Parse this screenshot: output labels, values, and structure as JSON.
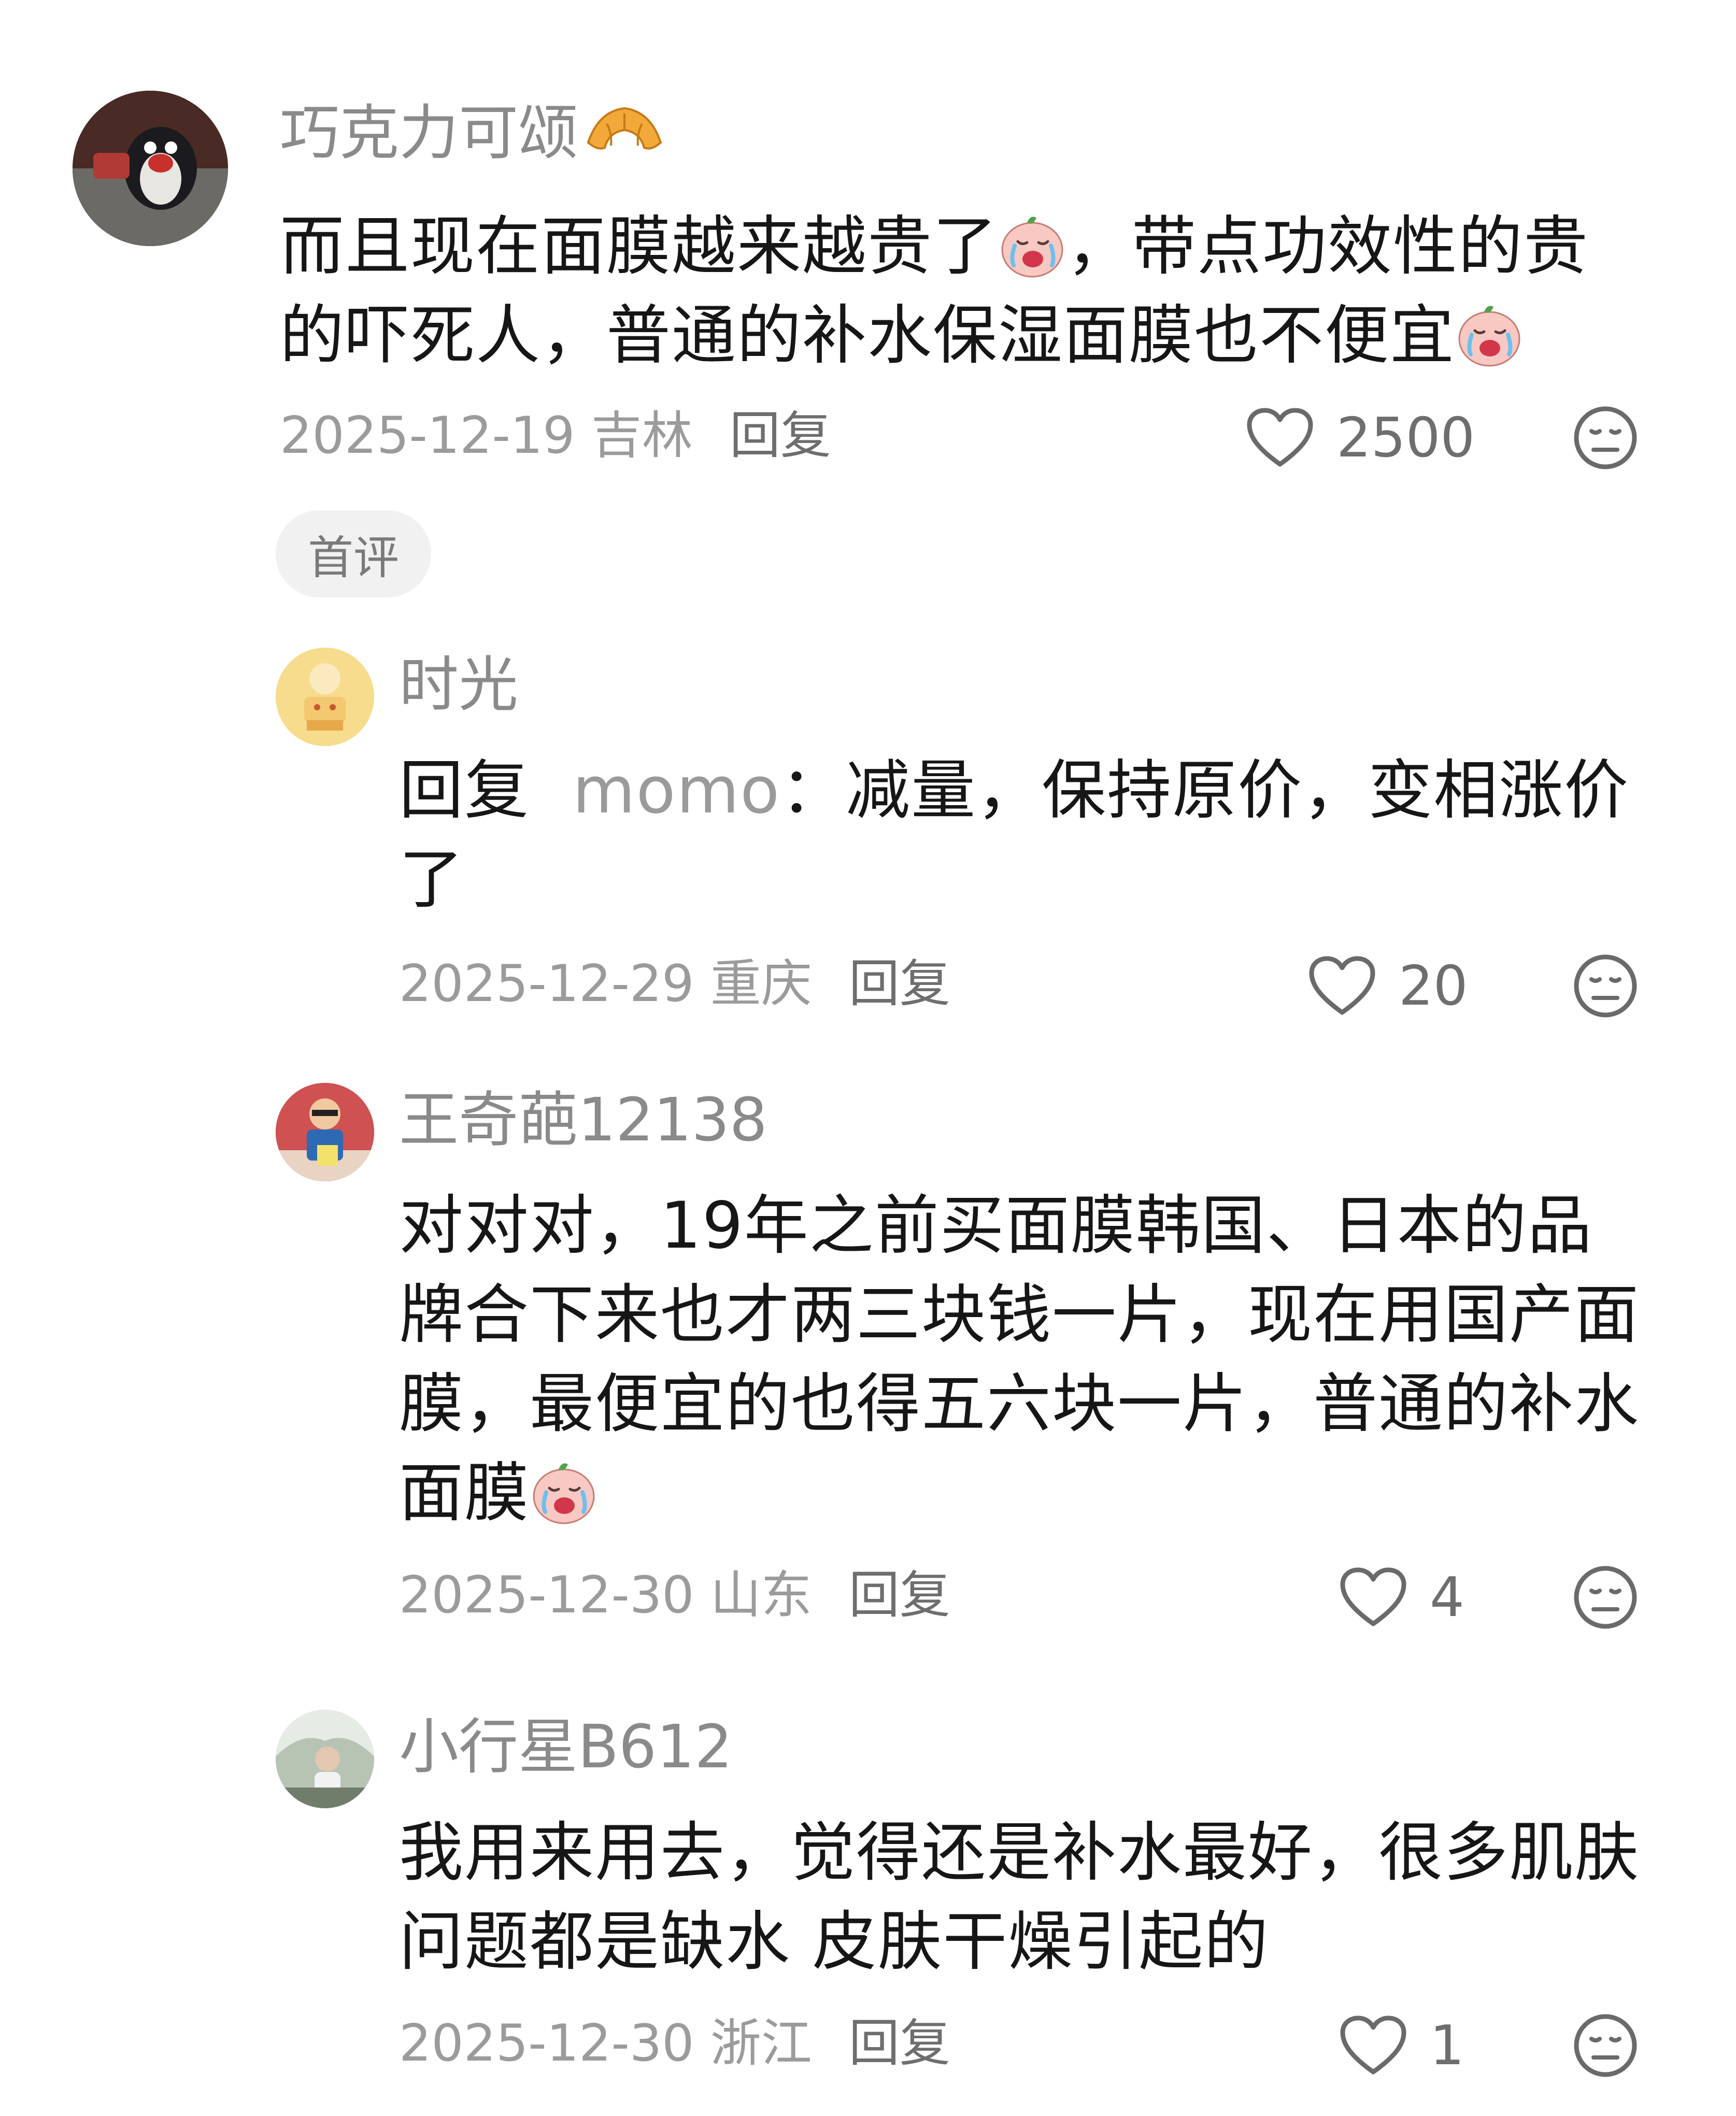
{
  "colors": {
    "name_text": "#8a8a8a",
    "body_text": "#161616",
    "meta_text": "#9b9b9b",
    "badge_bg": "#f1f1f1"
  },
  "comments": [
    {
      "username": "巧克力可颂",
      "username_emoji": "croissant-icon",
      "content_parts": [
        "而且现在面膜越来越贵了",
        "，带点功效性的贵的吓死人，普通的补水保湿面膜也不便宜"
      ],
      "date": "2025-12-19",
      "location": "吉林",
      "reply_label": "回复",
      "likes": "2500",
      "badge": "首评"
    },
    {
      "username": "时光",
      "reply_prefix": "回复",
      "reply_to": "momo",
      "content": "：减量，保持原价，变相涨价了",
      "date": "2025-12-29",
      "location": "重庆",
      "reply_label": "回复",
      "likes": "20"
    },
    {
      "username": "王奇葩12138",
      "content": "对对对，19年之前买面膜韩国、日本的品牌合下来也才两三块钱一片，现在用国产面膜，最便宜的也得五六块一片，普通的补水面膜",
      "date": "2025-12-30",
      "location": "山东",
      "reply_label": "回复",
      "likes": "4"
    },
    {
      "username": "小行星B612",
      "content": "我用来用去，觉得还是补水最好，很多肌肤问题都是缺水 皮肤干燥引起的",
      "date": "2025-12-30",
      "location": "浙江",
      "reply_label": "回复",
      "likes": "1"
    }
  ]
}
